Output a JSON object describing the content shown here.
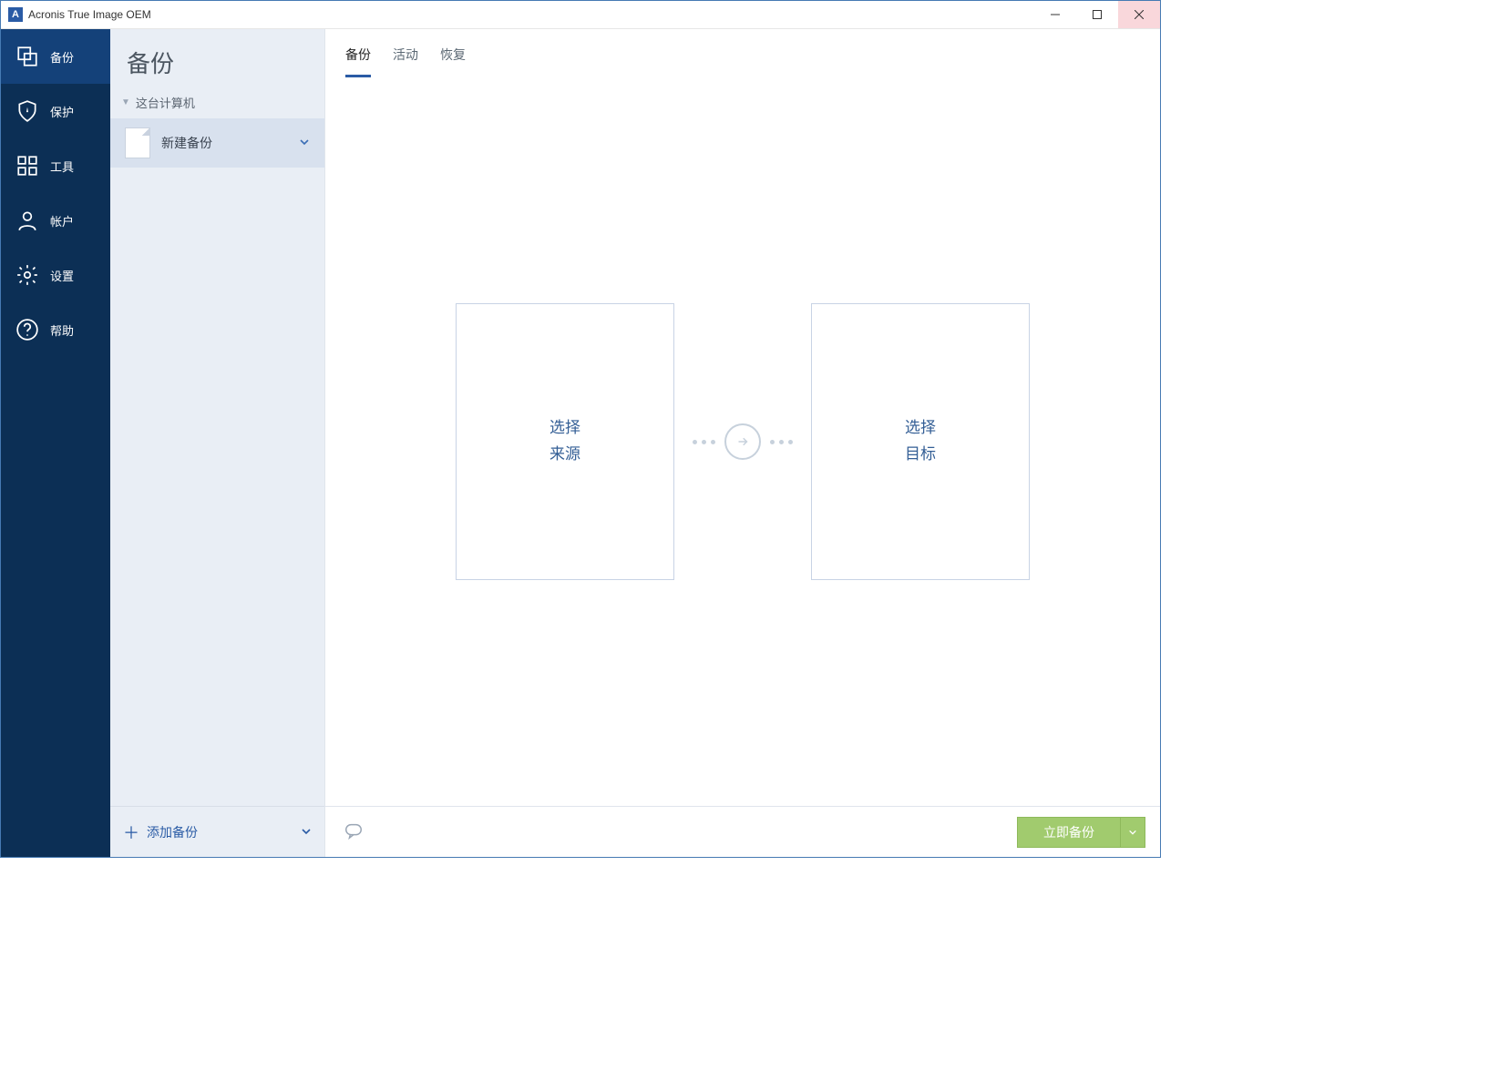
{
  "titlebar": {
    "title": "Acronis True Image OEM"
  },
  "sidebar": {
    "items": [
      {
        "label": "备份"
      },
      {
        "label": "保护"
      },
      {
        "label": "工具"
      },
      {
        "label": "帐户"
      },
      {
        "label": "设置"
      },
      {
        "label": "帮助"
      }
    ]
  },
  "listcol": {
    "title": "备份",
    "group": "这台计算机",
    "backup_item": "新建备份",
    "add_label": "添加备份"
  },
  "main": {
    "tabs": [
      {
        "label": "备份"
      },
      {
        "label": "活动"
      },
      {
        "label": "恢复"
      }
    ],
    "source": {
      "line1": "选择",
      "line2": "来源"
    },
    "target": {
      "line1": "选择",
      "line2": "目标"
    },
    "primary_button": "立即备份"
  }
}
